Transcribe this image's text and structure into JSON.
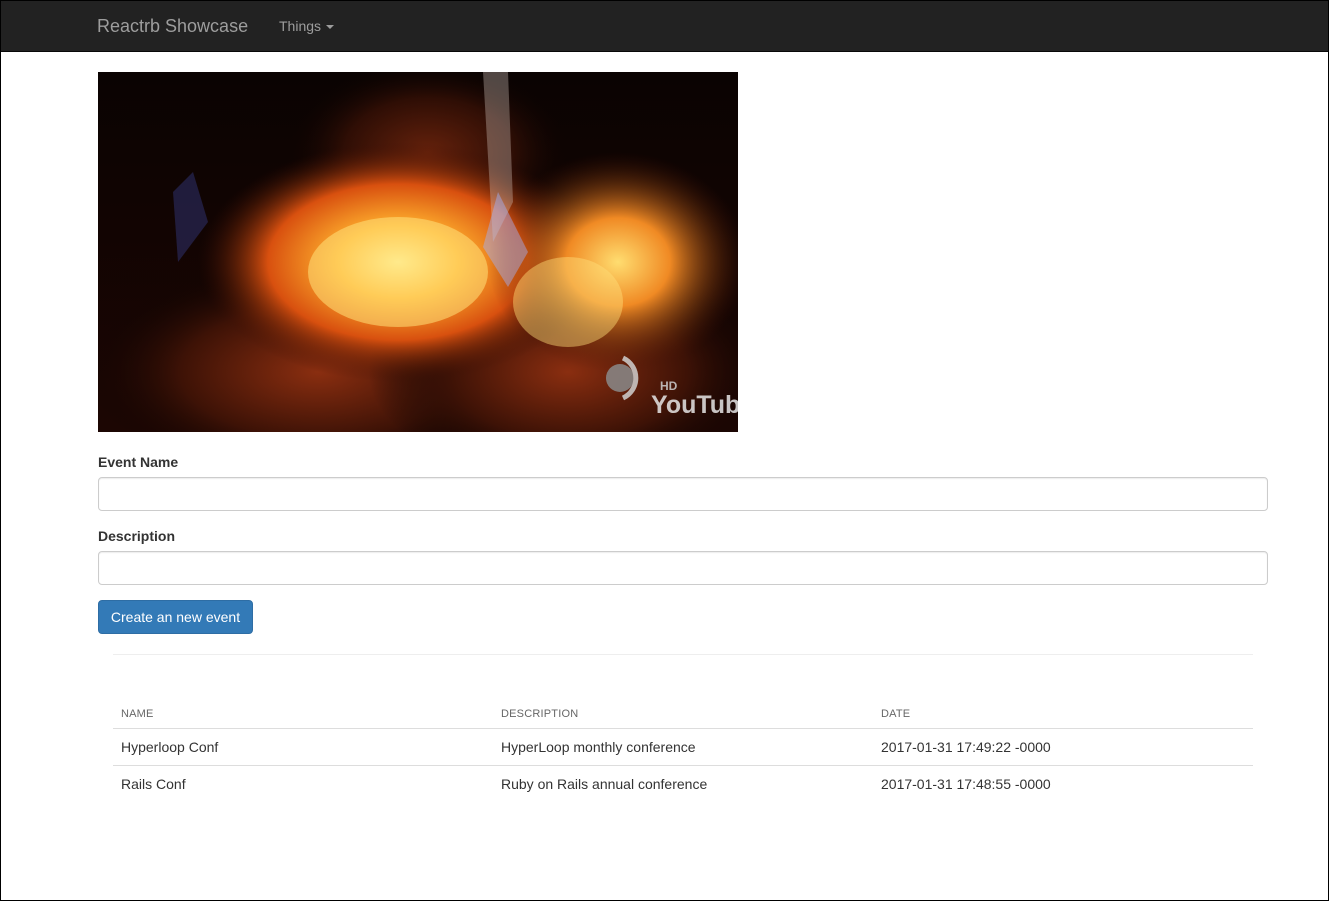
{
  "navbar": {
    "brand": "Reactrb Showcase",
    "dropdown_label": "Things"
  },
  "video": {
    "watermark_hd": "HD",
    "watermark_logo": "YouTube"
  },
  "form": {
    "event_name_label": "Event Name",
    "event_name_value": "",
    "description_label": "Description",
    "description_value": "",
    "submit_label": "Create an new event"
  },
  "table": {
    "headers": [
      "NAME",
      "DESCRIPTION",
      "DATE"
    ],
    "rows": [
      {
        "name": "Hyperloop Conf",
        "description": "HyperLoop monthly conference",
        "date": "2017-01-31 17:49:22 -0000"
      },
      {
        "name": "Rails Conf",
        "description": "Ruby on Rails annual conference",
        "date": "2017-01-31 17:48:55 -0000"
      }
    ]
  },
  "colors": {
    "navbar_bg": "#222222",
    "navbar_text": "#9d9d9d",
    "primary": "#337ab7"
  }
}
